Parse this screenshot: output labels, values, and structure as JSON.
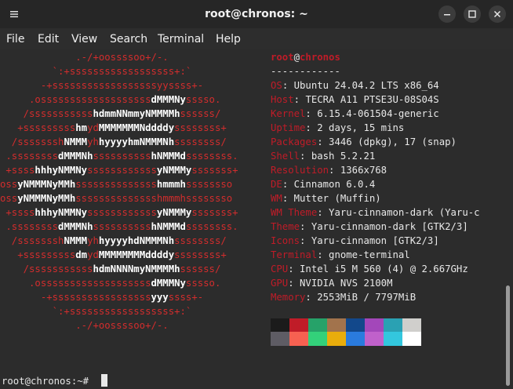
{
  "window": {
    "title": "root@chronos: ~",
    "menu_icon": "hamburger-icon",
    "minimize_icon": "minimize-icon",
    "maximize_icon": "maximize-icon",
    "close_icon": "close-icon"
  },
  "menubar": {
    "items": [
      "File",
      "Edit",
      "View",
      "Search",
      "Terminal",
      "Help"
    ]
  },
  "logo": {
    "lines": [
      [
        {
          "t": "             .-/+oossssoo+/-.",
          "w": false
        }
      ],
      [
        {
          "t": "         `:+ssssssssssssssssss+:`",
          "w": false
        }
      ],
      [
        {
          "t": "       -+ssssssssssssssssssyyssss+-",
          "w": false
        }
      ],
      [
        {
          "t": "     .osssssssssssssssssss",
          "w": false
        },
        {
          "t": "dMMMNy",
          "w": true
        },
        {
          "t": "sssso.",
          "w": false
        }
      ],
      [
        {
          "t": "    /sssssssssss",
          "w": false
        },
        {
          "t": "hdmmNNmmyNMMMMh",
          "w": true
        },
        {
          "t": "ssssss/",
          "w": false
        }
      ],
      [
        {
          "t": "   +sssssssss",
          "w": false
        },
        {
          "t": "hm",
          "w": true
        },
        {
          "t": "yd",
          "w": false
        },
        {
          "t": "MMMMMMMNddddy",
          "w": true
        },
        {
          "t": "ssssssss+",
          "w": false
        }
      ],
      [
        {
          "t": "  /sssssssh",
          "w": false
        },
        {
          "t": "NMMM",
          "w": true
        },
        {
          "t": "yh",
          "w": false
        },
        {
          "t": "hyyyyhmNMMMNh",
          "w": true
        },
        {
          "t": "ssssssss/",
          "w": false
        }
      ],
      [
        {
          "t": " .ssssssss",
          "w": false
        },
        {
          "t": "dMMMNh",
          "w": true
        },
        {
          "t": "ssssssssss",
          "w": false
        },
        {
          "t": "hNMMMd",
          "w": true
        },
        {
          "t": "ssssssss.",
          "w": false
        }
      ],
      [
        {
          "t": " +ssss",
          "w": false
        },
        {
          "t": "hhhyNMMNy",
          "w": true
        },
        {
          "t": "ssssssssssss",
          "w": false
        },
        {
          "t": "yNMMMy",
          "w": true
        },
        {
          "t": "sssssss+",
          "w": false
        }
      ],
      [
        {
          "t": "oss",
          "w": false
        },
        {
          "t": "yNMMMNyMMh",
          "w": true
        },
        {
          "t": "ssssssssssssss",
          "w": false
        },
        {
          "t": "hmmmh",
          "w": true
        },
        {
          "t": "ssssssso",
          "w": false
        }
      ],
      [
        {
          "t": "oss",
          "w": false
        },
        {
          "t": "yNMMMNyMMh",
          "w": true
        },
        {
          "t": "sssssssssssssshmmmhssssssso",
          "w": false
        }
      ],
      [
        {
          "t": " +ssss",
          "w": false
        },
        {
          "t": "hhhyNMMNy",
          "w": true
        },
        {
          "t": "ssssssssssss",
          "w": false
        },
        {
          "t": "yNMMMy",
          "w": true
        },
        {
          "t": "sssssss+",
          "w": false
        }
      ],
      [
        {
          "t": " .ssssssss",
          "w": false
        },
        {
          "t": "dMMMNh",
          "w": true
        },
        {
          "t": "ssssssssss",
          "w": false
        },
        {
          "t": "hNMMMd",
          "w": true
        },
        {
          "t": "ssssssss.",
          "w": false
        }
      ],
      [
        {
          "t": "  /sssssssh",
          "w": false
        },
        {
          "t": "NMMM",
          "w": true
        },
        {
          "t": "yh",
          "w": false
        },
        {
          "t": "hyyyyhdNMMMNh",
          "w": true
        },
        {
          "t": "ssssssss/",
          "w": false
        }
      ],
      [
        {
          "t": "   +sssssssss",
          "w": false
        },
        {
          "t": "dm",
          "w": true
        },
        {
          "t": "yd",
          "w": false
        },
        {
          "t": "MMMMMMMMddddy",
          "w": true
        },
        {
          "t": "ssssssss+",
          "w": false
        }
      ],
      [
        {
          "t": "    /sssssssssss",
          "w": false
        },
        {
          "t": "hdmNNNNmyNMMMMh",
          "w": true
        },
        {
          "t": "ssssss/",
          "w": false
        }
      ],
      [
        {
          "t": "     .osssssssssssssssssss",
          "w": false
        },
        {
          "t": "dMMMNy",
          "w": true
        },
        {
          "t": "sssso.",
          "w": false
        }
      ],
      [
        {
          "t": "       -+sssssssssssssssss",
          "w": false
        },
        {
          "t": "yyy",
          "w": true
        },
        {
          "t": "ssss+-",
          "w": false
        }
      ],
      [
        {
          "t": "         `:+ssssssssssssssssss+:`",
          "w": false
        }
      ],
      [
        {
          "t": "             .-/+oossssoo+/-.",
          "w": false
        }
      ]
    ]
  },
  "info": {
    "user": "root",
    "at": "@",
    "host": "chronos",
    "separator": "------------",
    "rows": [
      {
        "key": "OS",
        "value": "Ubuntu 24.04.2 LTS x86_64"
      },
      {
        "key": "Host",
        "value": "TECRA A11 PTSE3U-08S04S"
      },
      {
        "key": "Kernel",
        "value": "6.15.4-061504-generic"
      },
      {
        "key": "Uptime",
        "value": "2 days, 15 mins"
      },
      {
        "key": "Packages",
        "value": "3446 (dpkg), 17 (snap)"
      },
      {
        "key": "Shell",
        "value": "bash 5.2.21"
      },
      {
        "key": "Resolution",
        "value": "1366x768"
      },
      {
        "key": "DE",
        "value": "Cinnamon 6.0.4"
      },
      {
        "key": "WM",
        "value": "Mutter (Muffin)"
      },
      {
        "key": "WM Theme",
        "value": "Yaru-cinnamon-dark (Yaru-c"
      },
      {
        "key": "Theme",
        "value": "Yaru-cinnamon-dark [GTK2/3]"
      },
      {
        "key": "Icons",
        "value": "Yaru-cinnamon [GTK2/3]"
      },
      {
        "key": "Terminal",
        "value": "gnome-terminal"
      },
      {
        "key": "CPU",
        "value": "Intel i5 M 560 (4) @ 2.667GHz"
      },
      {
        "key": "GPU",
        "value": "NVIDIA NVS 2100M"
      },
      {
        "key": "Memory",
        "value": "2553MiB / 7797MiB"
      }
    ],
    "palette_row1": [
      "#1b1b1b",
      "#c01c28",
      "#26a269",
      "#a2734c",
      "#12488b",
      "#a347ba",
      "#2aa1b3",
      "#d0cfcc"
    ],
    "palette_row2": [
      "#5e5c64",
      "#f66151",
      "#33d17a",
      "#e9ad0c",
      "#2a7bde",
      "#c061cb",
      "#33c7de",
      "#ffffff"
    ]
  },
  "prompt": {
    "text": "root@chronos:~# "
  }
}
